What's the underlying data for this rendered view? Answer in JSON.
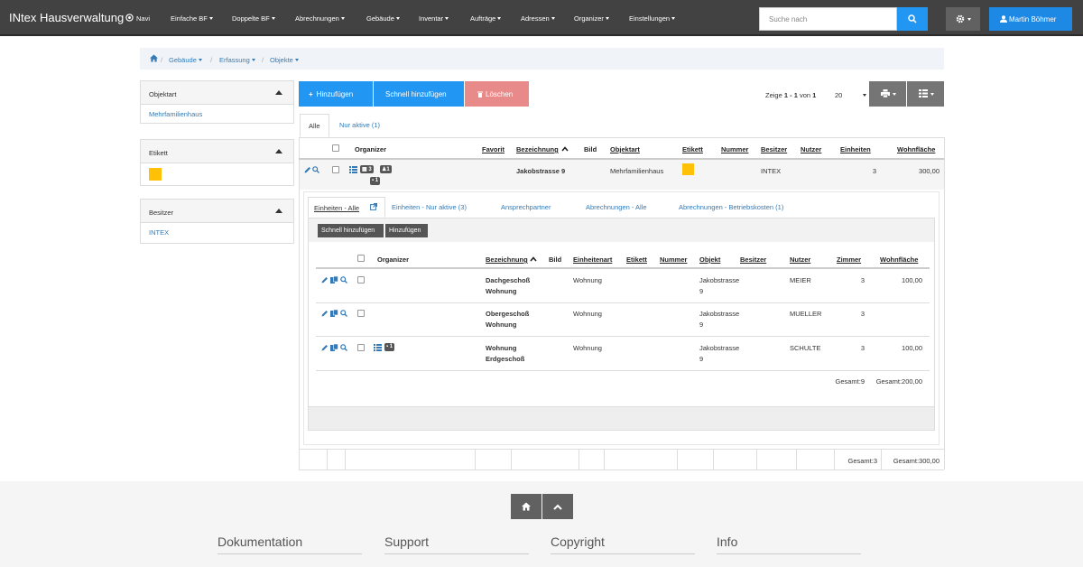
{
  "navbar": {
    "brand": "INtex Hausverwaltung",
    "items": [
      {
        "label": "Navi"
      },
      {
        "label": "Einfache BF"
      },
      {
        "label": "Doppelte BF"
      },
      {
        "label": "Abrechnungen"
      },
      {
        "label": "Gebäude"
      },
      {
        "label": "Inventar"
      },
      {
        "label": "Aufträge"
      },
      {
        "label": "Adressen"
      },
      {
        "label": "Organizer"
      },
      {
        "label": "Einstellungen"
      }
    ],
    "search_placeholder": "Suche nach",
    "user_name": "Martin Böhmer"
  },
  "breadcrumb": [
    "Gebäude",
    "Erfassung",
    "Objekte"
  ],
  "filters": [
    {
      "title": "Objektart",
      "value": "Mehrfamilienhaus"
    },
    {
      "title": "Etikett",
      "swatch_color": "#ffc107"
    },
    {
      "title": "Besitzer",
      "value": "INTEX"
    }
  ],
  "toolbar": {
    "add_label": "Hinzufügen",
    "quick_add_label": "Schnell hinzufügen",
    "delete_label": "Löschen",
    "paging_prefix": "Zeige ",
    "paging_range": "1 - 1",
    "paging_mid": " von ",
    "paging_total": "1",
    "page_size": "20"
  },
  "tabs": [
    {
      "label": "Alle",
      "active": true
    },
    {
      "label": "Nur aktive (1)",
      "active": false
    }
  ],
  "main_table": {
    "headers": {
      "organizer": "Organizer",
      "favorit": "Favorit",
      "bezeichnung": "Bezeichnung",
      "bild": "Bild",
      "objektart": "Objektart",
      "etikett": "Etikett",
      "nummer": "Nummer",
      "besitzer": "Besitzer",
      "nutzer": "Nutzer",
      "einheiten": "Einheiten",
      "wohnflaeche": "Wohnfläche"
    },
    "row": {
      "badges": [
        "3",
        "1",
        "1"
      ],
      "bezeichnung": "Jakobstrasse 9",
      "objektart": "Mehrfamilienhaus",
      "etikett_color": "#ffc107",
      "besitzer": "INTEX",
      "einheiten": "3",
      "wohnflaeche": "300,00"
    },
    "footer": {
      "einheiten_total": "Gesamt:3",
      "flaeche_total": "Gesamt:300,00"
    }
  },
  "sub_tabs": [
    {
      "label": "Einheiten - Alle",
      "active": true
    },
    {
      "label": "Einheiten - Nur aktive (3)",
      "active": false
    },
    {
      "label": "Ansprechpartner",
      "active": false
    },
    {
      "label": "Abrechnungen - Alle",
      "active": false
    },
    {
      "label": "Abrechnungen - Betriebskosten (1)",
      "active": false
    }
  ],
  "sub_toolbar": {
    "quick_add_label": "Schnell hinzufügen",
    "add_label": "Hinzufügen"
  },
  "sub_table": {
    "headers": {
      "organizer": "Organizer",
      "bezeichnung": "Bezeichnung",
      "bild": "Bild",
      "einheitenart": "Einheitenart",
      "etikett": "Etikett",
      "nummer": "Nummer",
      "objekt": "Objekt",
      "besitzer": "Besitzer",
      "nutzer": "Nutzer",
      "zimmer": "Zimmer",
      "wohnflaeche": "Wohnfläche"
    },
    "rows": [
      {
        "bezeichnung": [
          "Dachgeschoß",
          "Wohnung"
        ],
        "einheitenart": "Wohnung",
        "objekt": [
          "Jakobstrasse",
          "9"
        ],
        "nutzer": "MEIER",
        "zimmer": "3",
        "wohnflaeche": "100,00"
      },
      {
        "bezeichnung": [
          "Obergeschoß",
          "Wohnung"
        ],
        "einheitenart": "Wohnung",
        "objekt": [
          "Jakobstrasse",
          "9"
        ],
        "nutzer": "MUELLER",
        "zimmer": "3",
        "wohnflaeche": ""
      },
      {
        "bezeichnung": [
          "Wohnung",
          "Erdgeschoß"
        ],
        "einheitenart": "Wohnung",
        "objekt": [
          "Jakobstrasse",
          "9"
        ],
        "nutzer": "SCHULTE",
        "zimmer": "3",
        "wohnflaeche": "100,00",
        "badge": "1"
      }
    ],
    "footer": {
      "zimmer_total": "Gesamt:9",
      "flaeche_total": "Gesamt:200,00"
    }
  },
  "footer": {
    "headings": [
      "Dokumentation",
      "Support",
      "Copyright",
      "Info"
    ]
  }
}
